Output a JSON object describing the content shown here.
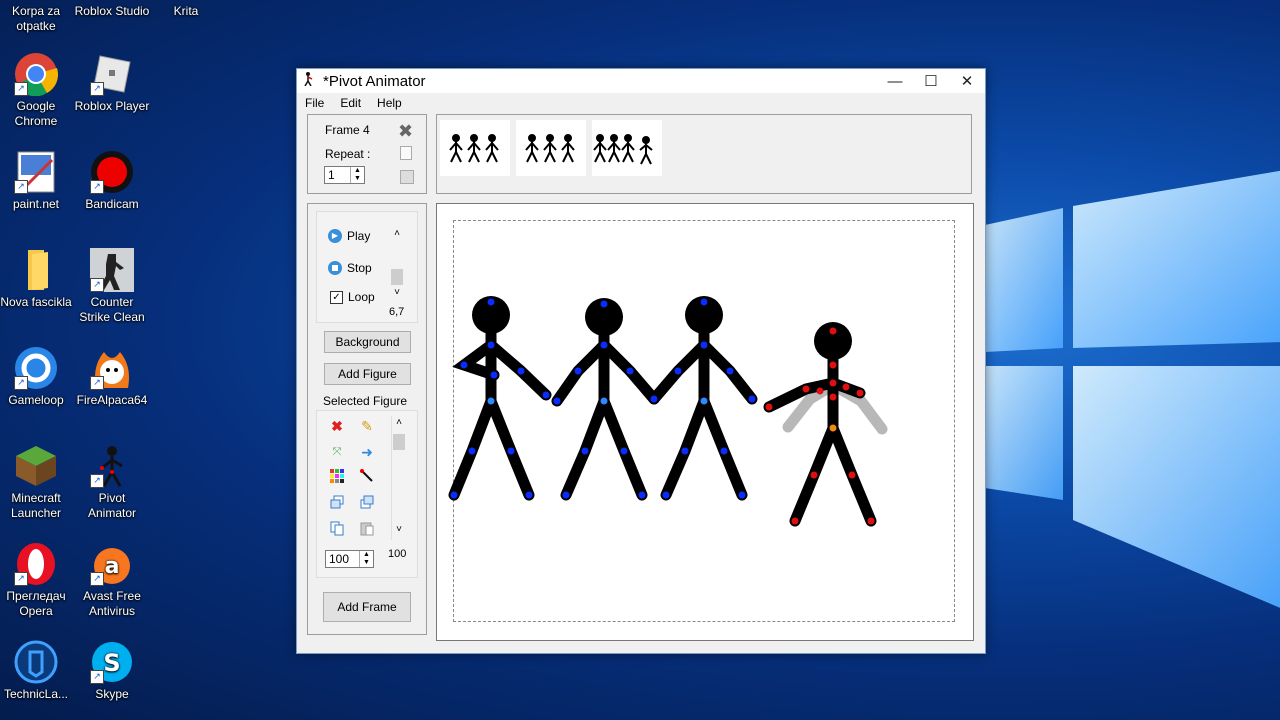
{
  "desktop": {
    "icons": [
      {
        "label": "Korpa za otpatke",
        "icon": "recycle-bin-icon"
      },
      {
        "label": "Roblox Studio",
        "icon": "roblox-studio-icon"
      },
      {
        "label": "Krita",
        "icon": "krita-icon"
      },
      {
        "label": "Google Chrome",
        "icon": "chrome-icon"
      },
      {
        "label": "Roblox Player",
        "icon": "roblox-player-icon"
      },
      {
        "label": "paint.net",
        "icon": "paintnet-icon"
      },
      {
        "label": "Bandicam",
        "icon": "bandicam-icon"
      },
      {
        "label": "Nova fascikla",
        "icon": "folder-icon"
      },
      {
        "label": "Counter Strike Clean",
        "icon": "counter-strike-icon"
      },
      {
        "label": "Gameloop",
        "icon": "gameloop-icon"
      },
      {
        "label": "FireAlpaca64",
        "icon": "firealpaca-icon"
      },
      {
        "label": "Minecraft Launcher",
        "icon": "minecraft-icon"
      },
      {
        "label": "Pivot Animator",
        "icon": "pivot-icon"
      },
      {
        "label": "Прегледач Opera",
        "icon": "opera-icon"
      },
      {
        "label": "Avast Free Antivirus",
        "icon": "avast-icon"
      },
      {
        "label": "TechnicLa...",
        "icon": "technic-icon"
      },
      {
        "label": "Skype",
        "icon": "skype-icon"
      }
    ]
  },
  "window": {
    "title": "*Pivot Animator",
    "menu": [
      "File",
      "Edit",
      "Help"
    ],
    "frame_panel": {
      "frame_label": "Frame 4",
      "repeat_label": "Repeat :",
      "repeat_value": "1"
    },
    "playback": {
      "play": "Play",
      "stop": "Stop",
      "loop": "Loop",
      "speed": "6,7"
    },
    "buttons": {
      "background": "Background",
      "add_figure": "Add Figure",
      "add_frame": "Add Frame"
    },
    "selected_figure": {
      "label": "Selected Figure",
      "scale_value": "100",
      "slider_value": "100"
    },
    "colors": {
      "accent": "#0078d7",
      "figure": "#000000",
      "joint_blue": "#0a2cff",
      "joint_red": "#e01010",
      "ghost": "#b8b8b8"
    }
  }
}
